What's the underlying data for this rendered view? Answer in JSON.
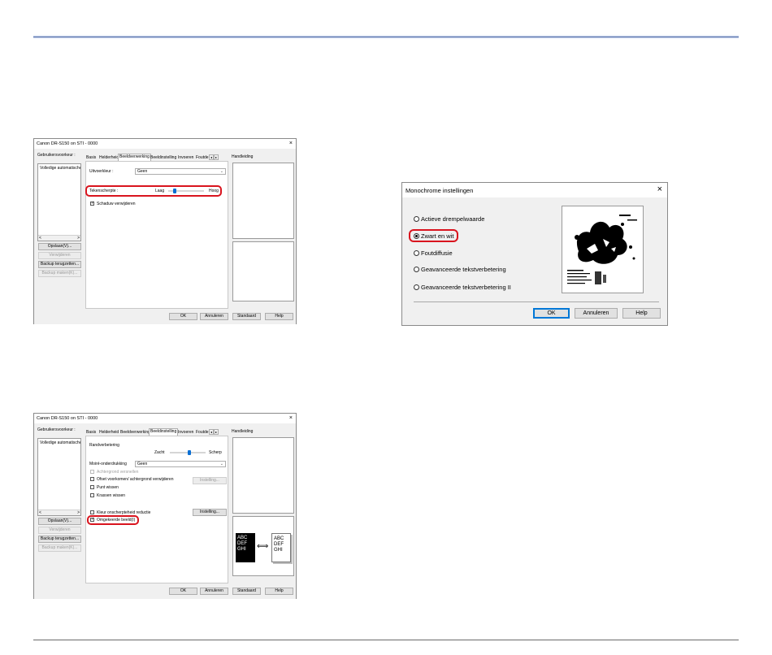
{
  "dialog_a": {
    "title": "Canon DR-S150 on STI - 0000",
    "close": "×",
    "settings_label": "Gebruikersvoorkeur :",
    "list_item": "Volledige automatische",
    "buttons": [
      "Opslaan(V)...",
      "Verwijderen",
      "Backup terugzetten...",
      "Backup maken(K)..."
    ],
    "tabs": [
      "Basis",
      "Helderheid",
      "Beeldverwerking",
      "Beeldinstelling",
      "Invoeren",
      "Foutde"
    ],
    "active_tab": "Beeldverwerking",
    "manual_label": "Handleiding",
    "uitvoer_label": "Uitvoerkleur :",
    "uitvoer_value": "Geen",
    "sharpness_label": "Tekenscherpte :",
    "sharpness_low": "Laag",
    "sharpness_high": "Hoog",
    "sharpness_level": 0.15,
    "shadow_label": "Schaduw verwijderen",
    "shadow_checked": true,
    "footer_buttons": [
      "OK",
      "Annuleren",
      "Standaard",
      "Help"
    ]
  },
  "dialog_b": {
    "title": "Canon DR-S150 on STI - 0000",
    "close": "×",
    "settings_label": "Gebruikersvoorkeur :",
    "list_item": "Volledige automatische",
    "buttons": [
      "Opslaan(V)...",
      "Verwijderen",
      "Backup terugzetten...",
      "Backup maken(K)..."
    ],
    "tabs": [
      "Basis",
      "Helderheid",
      "Beeldverwerking",
      "Beeldinstelling",
      "Invoeren",
      "Foutde"
    ],
    "active_tab": "Beeldinstelling",
    "manual_label": "Handleiding",
    "edge_label": "Randverbetering",
    "edge_soft": "Zacht",
    "edge_sharp": "Scherp",
    "edge_level": 0.55,
    "moire_label": "Moiré-onderdrukking",
    "moire_value": "Geen",
    "moire_sub_value": "",
    "bg_label": "Achtergrond versnellen",
    "ofset_label": "Ofset voorkomen/ achtergrond verwijderen",
    "settings_btn_1": "Instelling...",
    "punch_label": "Punt wissen",
    "scratch_label": "Krassen wissen",
    "reduce_label": "Kleur onscherpteheid reductie",
    "settings_btn_2": "Instelling...",
    "inverted_label": "Omgekeerde beeld(I)",
    "inverted_checked": true,
    "sample_dark": [
      "ABC",
      "DEF",
      "GHI"
    ],
    "sample_light": [
      "ABC",
      "DEF",
      "GHI"
    ],
    "arrow": "⟺",
    "footer_buttons": [
      "OK",
      "Annuleren",
      "Standaard",
      "Help"
    ]
  },
  "mono": {
    "title": "Monochrome instellingen",
    "close": "×",
    "options": [
      "Actieve drempelwaarde",
      "Zwart en wit",
      "Foutdiffusie",
      "Geavanceerde tekstverbetering",
      "Geavanceerde tekstverbetering II"
    ],
    "selected": "Zwart en wit",
    "buttons": [
      "OK",
      "Annuleren",
      "Help"
    ],
    "preview_text": "Dear Lorem Ipsum Dolor Amet"
  }
}
